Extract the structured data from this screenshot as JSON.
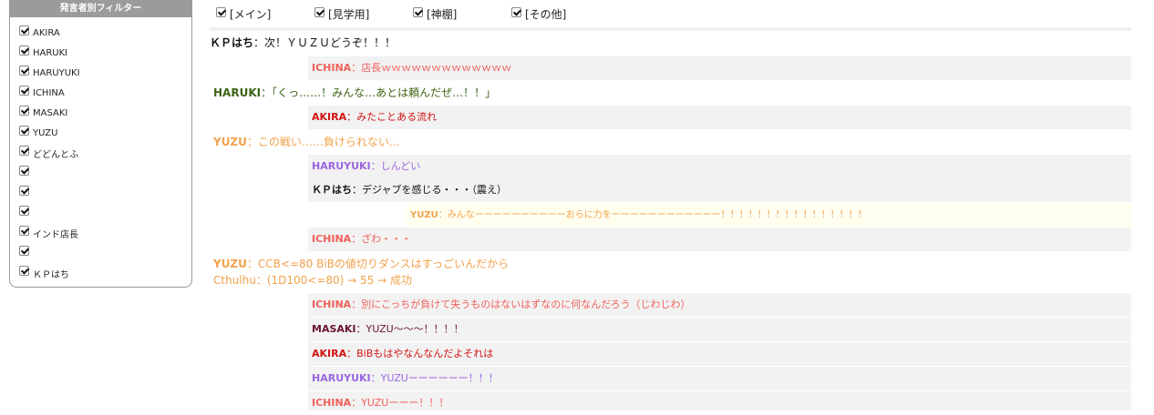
{
  "sidebar": {
    "title": "発言者別フィルター",
    "items": [
      {
        "label": "AKIRA",
        "checked": true
      },
      {
        "label": "HARUKI",
        "checked": true
      },
      {
        "label": "HARUYUKI",
        "checked": true
      },
      {
        "label": "ICHINA",
        "checked": true
      },
      {
        "label": "MASAKI",
        "checked": true
      },
      {
        "label": "YUZU",
        "checked": true
      },
      {
        "label": "どどんとふ",
        "checked": true
      },
      {
        "label": "",
        "checked": true
      },
      {
        "label": "",
        "checked": true
      },
      {
        "label": "",
        "checked": true
      },
      {
        "label": "インド店長",
        "checked": true
      },
      {
        "label": "",
        "checked": true
      },
      {
        "label": "ＫＰはち",
        "checked": true
      }
    ]
  },
  "tabs": [
    {
      "label": "[メイン]",
      "checked": true
    },
    {
      "label": "[見学用]",
      "checked": true
    },
    {
      "label": "[神棚]",
      "checked": true
    },
    {
      "label": "[その他]",
      "checked": true
    }
  ],
  "colors": {
    "kp": "#111111",
    "ichina": "#f0605a",
    "haruki": "#3c6314",
    "akira": "#d11414",
    "yuzu": "#f0a24a",
    "haruyuki": "#9a66e0",
    "masaki": "#6a1430"
  },
  "log": [
    {
      "name": "ＫＰはち",
      "sep": "：",
      "text": "次！ＹＵＺＵどうぞ！！！"
    },
    {
      "name": "ICHINA",
      "sep": "：",
      "text": "店長ｗｗｗｗｗｗｗｗｗｗｗｗｗ"
    },
    {
      "name": "HARUKI",
      "sep": "：",
      "text": "「くっ……！みんな…あとは頼んだぜ…！！」"
    },
    {
      "name": "AKIRA",
      "sep": "：",
      "text": "みたことある流れ"
    },
    {
      "name": "YUZU",
      "sep": "：",
      "text": "この戦い……負けられない…"
    },
    {
      "name": "HARUYUKI",
      "sep": "：",
      "text": "しんどい"
    },
    {
      "name": "ＫＰはち",
      "sep": "：",
      "text": "デジャブを感じる・・・（震え）"
    },
    {
      "name": "YUZU",
      "sep": "：",
      "text": "みんなーーーーーーーーーーおらに力をーーーーーーーーーーーー！！！！！！！！！！！！！！！！"
    },
    {
      "name": "ICHINA",
      "sep": "：",
      "text": "ざわ・・・"
    },
    {
      "name": "YUZU",
      "sep": "：",
      "text": "CCB<=80 BiBの値切りダンスはすっごいんだから",
      "line2": "Cthulhu：(1D100<=80) → 55 → 成功"
    },
    {
      "name": "ICHINA",
      "sep": "：",
      "text": "別にこっちが負けて失うものはないはずなのに何なんだろう（じわじわ）"
    },
    {
      "name": "MASAKI",
      "sep": "：",
      "text": "YUZU〜〜〜！！！！"
    },
    {
      "name": "AKIRA",
      "sep": "：",
      "text": "BiBもはやなんなんだよそれは"
    },
    {
      "name": "HARUYUKI",
      "sep": "：",
      "text": "YUZUーーーーーー！！！"
    },
    {
      "name": "ICHINA",
      "sep": "：",
      "text": "YUZUーーー！！！"
    }
  ]
}
